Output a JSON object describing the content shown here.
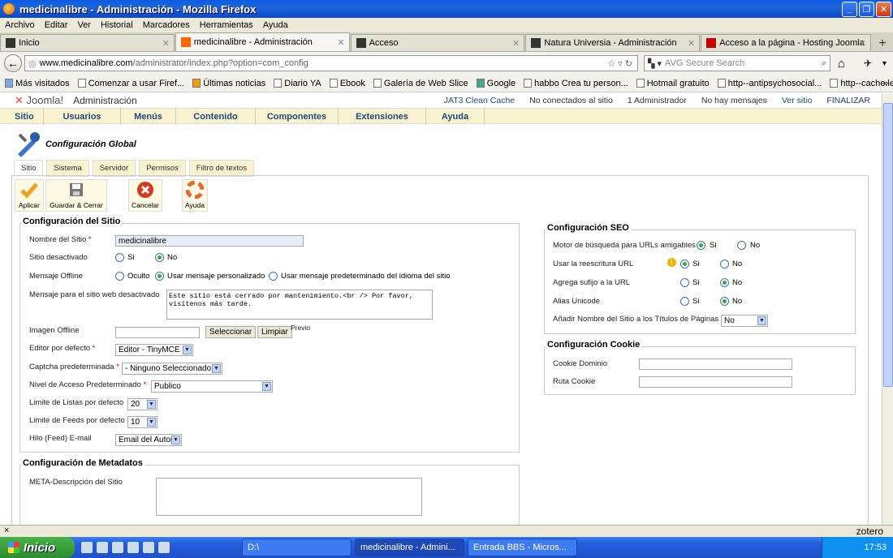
{
  "window": {
    "title": "medicinalibre - Administración - Mozilla Firefox"
  },
  "menubar": [
    "Archivo",
    "Editar",
    "Ver",
    "Historial",
    "Marcadores",
    "Herramientas",
    "Ayuda"
  ],
  "tabs": [
    {
      "label": "Inicio"
    },
    {
      "label": "medicinalibre - Administración"
    },
    {
      "label": "Acceso"
    },
    {
      "label": "Natura Universia - Administración"
    },
    {
      "label": "Acceso a la página - Hosting Joomla"
    }
  ],
  "nav": {
    "url_host": "www.medicinalibre.com",
    "url_path": "/administrator/index.php?option=com_config",
    "search_placeholder": "AVG Secure Search"
  },
  "bookmarks": [
    "Más visitados",
    "Comenzar a usar Firef...",
    "Últimas noticias",
    "Diario YA",
    "Ebook",
    "Galería de Web Slice",
    "Google",
    "habbo Crea tu person...",
    "Hotmail gratuito",
    "http--antipsychosocial...",
    "http--cache.lego.com-..."
  ],
  "joomla": {
    "brand": "Joomla!",
    "admin": "Administración",
    "status": [
      "JAT3 Clean Cache",
      "No conectados al sitio",
      "1 Administrador",
      "No hay mensajes",
      "Ver sitio",
      "FINALIZAR"
    ],
    "menu": [
      "Sitio",
      "Usuarios",
      "Menús",
      "Contenido",
      "Componentes",
      "Extensiones",
      "Ayuda"
    ],
    "page_title": "Configuración Global",
    "config_tabs": [
      "Sitio",
      "Sistema",
      "Servidor",
      "Permisos",
      "Filtro de textos"
    ],
    "toolbar": [
      "Aplicar",
      "Guardar & Cerrar",
      "Cancelar",
      "Ayuda"
    ],
    "site": {
      "legend": "Configuración del Sitio",
      "site_name_label": "Nombre del Sitio",
      "site_name_value": "medicinalibre",
      "offline_label": "Sitio desactivado",
      "si": "Si",
      "no": "No",
      "offline_msg_label": "Mensaje Offline",
      "opt_hidden": "Oculto",
      "opt_custom": "Usar mensaje personalizado",
      "opt_default": "Usar mensaje predeterminado del idioma del sitio",
      "offline_text_label": "Mensaje para el sitio web desactivado",
      "offline_text_value": "Este sitio está cerrado por mantenimiento.<br /> Por favor, visítenos más tarde.",
      "image_label": "Imagen Offline",
      "select_btn": "Seleccionar",
      "clear_btn": "Limpiar",
      "preview": "Previo",
      "editor_label": "Editor por defecto",
      "editor_value": "Editor - TinyMCE",
      "captcha_label": "Captcha predeterminada",
      "captcha_value": "- Ninguno Seleccionado -",
      "access_label": "Nivel de Acceso Predeterminado",
      "access_value": "Publico",
      "list_limit_label": "Limite de Listas por defecto",
      "list_limit_value": "20",
      "feed_limit_label": "Limite de Feeds por defecto",
      "feed_limit_value": "10",
      "feed_email_label": "Hilo (Feed) E-mail",
      "feed_email_value": "Email del Autor"
    },
    "meta": {
      "legend": "Configuración de Metadatos",
      "desc_label": "META-Descripción del Sitio"
    },
    "seo": {
      "legend": "Configuración SEO",
      "sef_label": "Motor de búsqueda para URLs amigables",
      "rewrite_label": "Usar la reescritura URL",
      "suffix_label": "Agrega sufijo a la URL",
      "unicode_label": "Alias Unicode",
      "sitename_label": "Añadir Nombre del Sitio a los Títulos de Páginas",
      "sitename_value": "No"
    },
    "cookie": {
      "legend": "Configuración Cookie",
      "domain_label": "Cookie Dominio",
      "path_label": "Ruta Cookie"
    }
  },
  "statusbar": {
    "close": "×",
    "zotero": "zotero"
  },
  "taskbar": {
    "start": "Inicio",
    "tasks": [
      "D:\\",
      "medicinalibre - Admini...",
      "Entrada BBS - Micros..."
    ],
    "clock": "17:53"
  }
}
